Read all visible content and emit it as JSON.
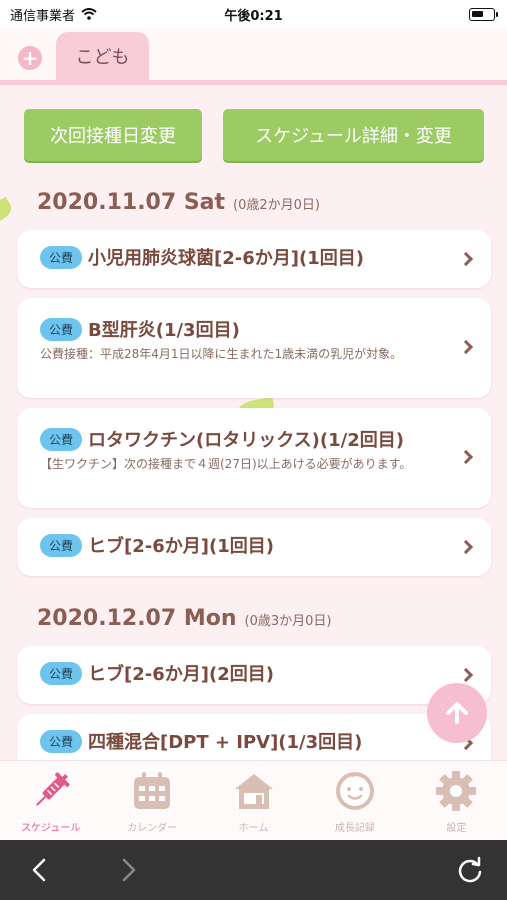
{
  "status_bar": {
    "carrier": "通信事業者",
    "time": "午後0:21"
  },
  "tabs": {
    "add_label": "+",
    "active_child": "こども"
  },
  "actions": {
    "change_next": "次回接種日変更",
    "schedule_detail": "スケジュール詳細・変更"
  },
  "groups": [
    {
      "date": "2020.11.07 Sat",
      "age": "(0歳2か月0日)",
      "items": [
        {
          "badge": "公費",
          "title": "小児用肺炎球菌[2-6か月](1回目)",
          "note": ""
        },
        {
          "badge": "公費",
          "title": "B型肝炎(1/3回目)",
          "note": "公費接種：平成28年4月1日以降に生まれた1歳未満の乳児が対象。"
        },
        {
          "badge": "公費",
          "title": "ロタワクチン(ロタリックス)(1/2回目)",
          "note": "【生ワクチン】次の接種まで４週(27日)以上あける必要があります。"
        },
        {
          "badge": "公費",
          "title": "ヒブ[2-6か月](1回目)",
          "note": ""
        }
      ]
    },
    {
      "date": "2020.12.07 Mon",
      "age": "(0歳3か月0日)",
      "items": [
        {
          "badge": "公費",
          "title": "ヒブ[2-6か月](2回目)",
          "note": ""
        },
        {
          "badge": "公費",
          "title": "四種混合[DPT + IPV](1/3回目)",
          "note": ""
        }
      ]
    }
  ],
  "bottom_nav": [
    {
      "label": "スケジュール",
      "icon": "syringe-icon",
      "active": true
    },
    {
      "label": "カレンダー",
      "icon": "calendar-icon",
      "active": false
    },
    {
      "label": "ホーム",
      "icon": "home-icon",
      "active": false
    },
    {
      "label": "成長記録",
      "icon": "baby-face-icon",
      "active": false
    },
    {
      "label": "設定",
      "icon": "gear-icon",
      "active": false
    }
  ],
  "colors": {
    "accent_pink": "#e05a8a",
    "button_green": "#9ccb64",
    "badge_blue": "#6cc4ef",
    "background": "#fdf0f3"
  }
}
